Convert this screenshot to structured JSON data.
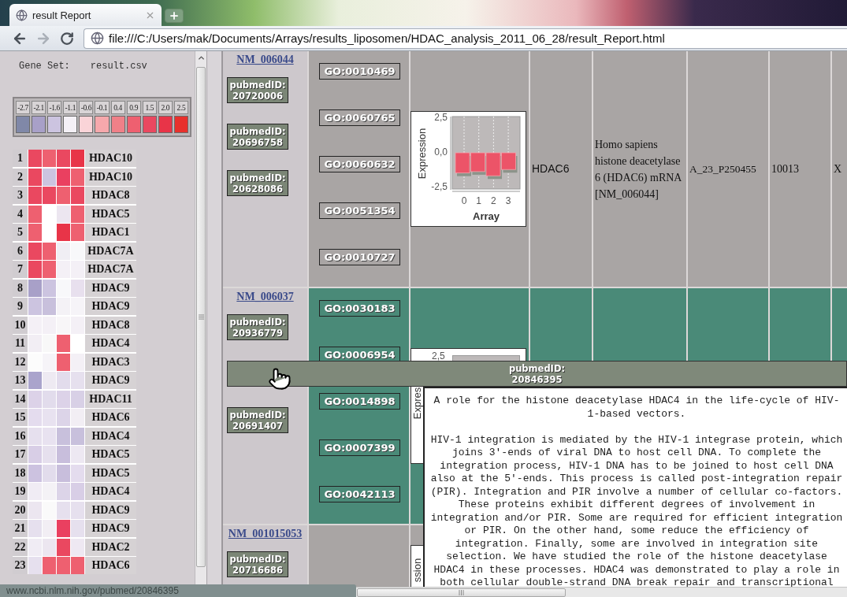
{
  "browser": {
    "tab": {
      "title": "result Report",
      "selected": true
    },
    "nav": [
      {
        "kind": "back",
        "disabled": false
      },
      {
        "kind": "forward",
        "disabled": true
      },
      {
        "kind": "reload",
        "disabled": false
      }
    ],
    "url": "file:///C:/Users/mak/Documents/Arrays/results_liposomen/HDAC_analysis_2011_06_28/result_Report.html"
  },
  "sidebar": {
    "gene_set_label": "Gene Set:",
    "gene_set_file": "result.csv",
    "legend": [
      {
        "label": "-2.7",
        "color": "#8088a8"
      },
      {
        "label": "-2.1",
        "color": "#a8a0c8"
      },
      {
        "label": "-1.6",
        "color": "#ccc4e0"
      },
      {
        "label": "-1.1",
        "color": "#f4f0f6"
      },
      {
        "label": "-0.6",
        "color": "#fad4d8"
      },
      {
        "label": "-0.1",
        "color": "#f6a8ac"
      },
      {
        "label": "0.4",
        "color": "#f08088"
      },
      {
        "label": "0.9",
        "color": "#ee6070"
      },
      {
        "label": "1.5",
        "color": "#ea4860"
      },
      {
        "label": "2.0",
        "color": "#e83448"
      },
      {
        "label": "2.5",
        "color": "#e8302c"
      }
    ],
    "heatmap": [
      {
        "rank": "1",
        "gene": "HDAC10",
        "cells": [
          {
            "color": "#ea4860"
          },
          {
            "color": "#ee6070"
          },
          {
            "color": "#ea4860"
          },
          {
            "color": "#e83448"
          }
        ]
      },
      {
        "rank": "2",
        "gene": "HDAC10",
        "cells": [
          {
            "color": "#ea4860"
          },
          {
            "color": "#ccc4e0"
          },
          {
            "color": "#ea4060"
          },
          {
            "color": "#ee6070"
          }
        ]
      },
      {
        "rank": "3",
        "gene": "HDAC8",
        "cells": [
          {
            "color": "#ea4860"
          },
          {
            "color": "#ea4860"
          },
          {
            "color": "#ee6070"
          },
          {
            "color": "#ea4860"
          }
        ]
      },
      {
        "rank": "4",
        "gene": "HDAC5",
        "cells": [
          {
            "color": "#ee6070"
          },
          {
            "color": "#ffffff"
          },
          {
            "color": "#ece6f0"
          },
          {
            "color": "#ee6070"
          }
        ]
      },
      {
        "rank": "5",
        "gene": "HDAC1",
        "cells": [
          {
            "color": "#ee6070"
          },
          {
            "color": "#ffffff"
          },
          {
            "color": "#e83448"
          },
          {
            "color": "#ee6070"
          }
        ]
      },
      {
        "rank": "6",
        "gene": "HDAC7A",
        "cells": [
          {
            "color": "#ea4860"
          },
          {
            "color": "#ee6070"
          },
          {
            "color": "#f0eef4"
          },
          {
            "color": "#f8f8fa"
          }
        ]
      },
      {
        "rank": "7",
        "gene": "HDAC7A",
        "cells": [
          {
            "color": "#ea4860"
          },
          {
            "color": "#ee6070"
          },
          {
            "color": "#f4f0f6"
          },
          {
            "color": "#f4f0f6"
          }
        ]
      },
      {
        "rank": "8",
        "gene": "HDAC9",
        "cells": [
          {
            "color": "#a8a0c8"
          },
          {
            "color": "#ccc4e0"
          },
          {
            "color": "#f8f8fa"
          },
          {
            "color": "#e8e0ee"
          }
        ]
      },
      {
        "rank": "9",
        "gene": "HDAC9",
        "cells": [
          {
            "color": "#ccc4e0"
          },
          {
            "color": "#c8c0dc"
          },
          {
            "color": "#f4f2f6"
          },
          {
            "color": "#f6f4f8"
          }
        ]
      },
      {
        "rank": "10",
        "gene": "HDAC8",
        "cells": [
          {
            "color": "#f4f0f6"
          },
          {
            "color": "#f4f0f6"
          },
          {
            "color": "#f8f6f8"
          },
          {
            "color": "#f4f0f6"
          }
        ]
      },
      {
        "rank": "11",
        "gene": "HDAC4",
        "cells": [
          {
            "color": "#f2eef4"
          },
          {
            "color": "#f8f8f8"
          },
          {
            "color": "#ee6070"
          },
          {
            "color": "#ffffff"
          }
        ]
      },
      {
        "rank": "12",
        "gene": "HDAC3",
        "cells": [
          {
            "color": "#fcfcfc"
          },
          {
            "color": "#f6f4f8"
          },
          {
            "color": "#ee6070"
          },
          {
            "color": "#f4f0f6"
          }
        ]
      },
      {
        "rank": "13",
        "gene": "HDAC9",
        "cells": [
          {
            "color": "#aaa4cc"
          },
          {
            "color": "#eeeaf2"
          },
          {
            "color": "#e2dcec"
          },
          {
            "color": "#e6e0ee"
          }
        ]
      },
      {
        "rank": "14",
        "gene": "HDAC11",
        "cells": [
          {
            "color": "#dcd2e8"
          },
          {
            "color": "#e2dcec"
          },
          {
            "color": "#dcd2e8"
          },
          {
            "color": "#d8d0e6"
          }
        ]
      },
      {
        "rank": "15",
        "gene": "HDAC6",
        "cells": [
          {
            "color": "#e4dcee"
          },
          {
            "color": "#e8e2f0"
          },
          {
            "color": "#dcd4e8"
          },
          {
            "color": "#f2eef4"
          }
        ]
      },
      {
        "rank": "16",
        "gene": "HDAC4",
        "cells": [
          {
            "color": "#e6e0ee"
          },
          {
            "color": "#e8e2f0"
          },
          {
            "color": "#c8c0dc"
          },
          {
            "color": "#c8c0dc"
          }
        ]
      },
      {
        "rank": "17",
        "gene": "HDAC5",
        "cells": [
          {
            "color": "#d8cee6"
          },
          {
            "color": "#e6e0ee"
          },
          {
            "color": "#c8bedc"
          },
          {
            "color": "#ede8f2"
          }
        ]
      },
      {
        "rank": "18",
        "gene": "HDAC5",
        "cells": [
          {
            "color": "#ccc2e0"
          },
          {
            "color": "#e2dcec"
          },
          {
            "color": "#c8bedc"
          },
          {
            "color": "#e4dcee"
          }
        ]
      },
      {
        "rank": "19",
        "gene": "HDAC4",
        "cells": [
          {
            "color": "#f0ecf4"
          },
          {
            "color": "#f4f2f6"
          },
          {
            "color": "#dcd4e8"
          },
          {
            "color": "#d8cee6"
          }
        ]
      },
      {
        "rank": "20",
        "gene": "HDAC9",
        "cells": [
          {
            "color": "#ece6f0"
          },
          {
            "color": "#fafafa"
          },
          {
            "color": "#e6e0ee"
          },
          {
            "color": "#e6e0ee"
          }
        ]
      },
      {
        "rank": "21",
        "gene": "HDAC9",
        "cells": [
          {
            "color": "#e6e0ee"
          },
          {
            "color": "#f2eef4"
          },
          {
            "color": "#ea4060"
          },
          {
            "color": "#e6e0ee"
          }
        ]
      },
      {
        "rank": "22",
        "gene": "HDAC2",
        "cells": [
          {
            "color": "#f0ecf4"
          },
          {
            "color": "#ece6f0"
          },
          {
            "color": "#ea4860"
          },
          {
            "color": "#eee8f2"
          }
        ]
      },
      {
        "rank": "23",
        "gene": "HDAC6",
        "cells": [
          {
            "color": "#e6e0ee"
          },
          {
            "color": "#ee6070"
          },
          {
            "color": "#ee6070"
          },
          {
            "color": "#ee6070"
          }
        ]
      }
    ]
  },
  "table": {
    "rows": [
      {
        "accession": "NM_006044",
        "selected": false,
        "pubmed": [
          {
            "label": "pubmedID:",
            "id": "20720006",
            "hovered": false
          },
          {
            "label": "pubmedID:",
            "id": "20696758",
            "hovered": false
          },
          {
            "label": "pubmedID:",
            "id": "20628086",
            "hovered": false
          }
        ],
        "go_terms": [
          "GO:0010469",
          "GO:0060765",
          "GO:0060632",
          "GO:0051354",
          "GO:0010727"
        ],
        "chart": {
          "kind": "full",
          "chart_data": {
            "type": "bar",
            "grid": true,
            "xlabel": "Array",
            "ylabel": "Expression",
            "categories": [
              "0",
              "1",
              "2",
              "3"
            ],
            "values": [
              -1.45,
              -1.35,
              -1.65,
              -1.2
            ],
            "ylim": [
              -2.6,
              2.6
            ],
            "yticks": [
              {
                "value": 2.5,
                "label": "2,5"
              },
              {
                "value": 0,
                "label": "0,0"
              },
              {
                "value": -2.5,
                "label": "-2,5"
              }
            ]
          }
        },
        "gene": "HDAC6",
        "description": "Homo sapiens histone deacetylase 6 (HDAC6) mRNA [NM_006044]",
        "probe": "A_23_P250455",
        "column_7": "10013",
        "column_8": "X"
      },
      {
        "accession": "NM_006037",
        "selected": true,
        "pubmed": [
          {
            "label": "pubmedID:",
            "id": "20936779",
            "hovered": false
          },
          {
            "label": "pubmedID:",
            "id": "20846395",
            "hovered": true,
            "abstract": {
              "title": "A role for the histone deacetylase HDAC4 in the life-cycle of HIV-1-based vectors.",
              "body": "HIV-1 integration is mediated by the HIV-1 integrase protein, which joins 3'-ends of viral DNA to host cell DNA. To complete the integration process, HIV-1 DNA has to be joined to host cell DNA also at the 5'-ends. This process is called post-integration repair (PIR). Integration and PIR involve a number of cellular co-factors. These proteins exhibit different degrees of involvement in integration and/or PIR. Some are required for efficient integration or PIR. On the other hand, some reduce the efficiency of integration. Finally, some are involved in integration site selection. We have studied the role of the histone deacetylase HDAC4 in these processes. HDAC4 was demonstrated to play a role in both cellular double-strand DNA break repair and transcriptional"
            }
          },
          {
            "label": "pubmedID:",
            "id": "20691407",
            "hovered": false
          }
        ],
        "go_terms": [
          "GO:0030183",
          "GO:0006954",
          "GO:0014898",
          "GO:0007399",
          "GO:0042113"
        ],
        "chart": {
          "kind": "partial",
          "ytick": "2,5",
          "ylabel": "Expres"
        }
      },
      {
        "accession": "NM_001015053",
        "selected": false,
        "pubmed": [
          {
            "label": "pubmedID:",
            "id": "20716686",
            "hovered": false
          }
        ],
        "chart": {
          "kind": "partial",
          "ylabel": "ssion"
        }
      }
    ]
  },
  "status_bar": "www.ncbi.nlm.nih.gov/pubmed/20846395"
}
